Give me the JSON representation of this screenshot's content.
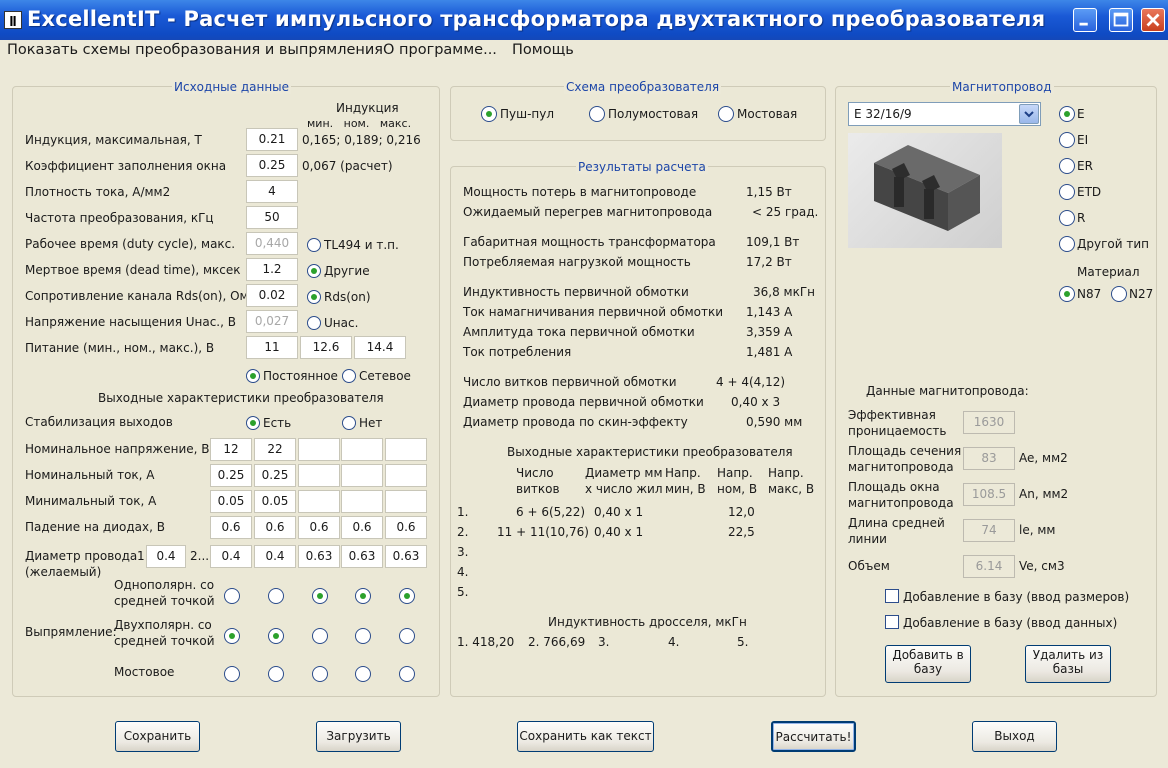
{
  "window": {
    "title": "ExcellentIT - Расчет импульсного трансформатора двухтактного преобразователя"
  },
  "menu": [
    "Показать схемы преобразования и выпрямления",
    "О программе...",
    "Помощь"
  ],
  "input": {
    "title": "Исходные данные",
    "ind_header": "Индукция",
    "ind_cols": "мин.   ном.   макс.",
    "ind_vals": "0,165; 0,189; 0,216",
    "rows": [
      {
        "label": "Индукция, максимальная, Т",
        "value": "0.21"
      },
      {
        "label": "Коэффициент заполнения окна",
        "value": "0.25",
        "note": "0,067 (расчет)"
      },
      {
        "label": "Плотность тока, А/мм2",
        "value": "4"
      },
      {
        "label": "Частота преобразования, кГц",
        "value": "50"
      },
      {
        "label": "Рабочее время (duty cycle), макс.",
        "value": "0,440",
        "radio": "TL494 и т.п."
      },
      {
        "label": "Мертвое время (dead time), мксек",
        "value": "1.2",
        "radio": "Другие"
      },
      {
        "label": "Сопротивление канала Rds(on), Ом",
        "value": "0.02",
        "radio": "Rds(on)"
      },
      {
        "label": "Напряжение насыщения Uнас., В",
        "value": "0,027",
        "radio": "Uнас."
      },
      {
        "label": "Питание (мин., ном., макс.), В",
        "values": [
          "11",
          "12.6",
          "14.4"
        ]
      }
    ],
    "supply": [
      "Постоянное",
      "Сетевое"
    ],
    "out_title": "Выходные характеристики преобразователя",
    "stab_label": "Стабилизация выходов",
    "stab_opts": [
      "Есть",
      "Нет"
    ],
    "out_rows": [
      {
        "label": "Номинальное напряжение, В",
        "values": [
          "12",
          "22",
          "",
          "",
          ""
        ]
      },
      {
        "label": "Номинальный ток, А",
        "values": [
          "0.25",
          "0.25",
          "",
          "",
          ""
        ]
      },
      {
        "label": "Минимальный ток, А",
        "values": [
          "0.05",
          "0.05",
          "",
          "",
          ""
        ]
      },
      {
        "label": "Падение на диодах, В",
        "values": [
          "0.6",
          "0.6",
          "0.6",
          "0.6",
          "0.6"
        ]
      }
    ],
    "wire_label1": "Диаметр провода",
    "wire_label2": "(желаемый)",
    "wire_n1": "1",
    "wire_n2": "2...",
    "wire_vals": [
      "0.4",
      "0.4",
      "0.4",
      "0.63",
      "0.63",
      "0.63"
    ],
    "rect_label": "Выпрямление:",
    "rect_types": [
      {
        "l1": "Однополярн. со",
        "l2": "средней точкой",
        "sel": [
          false,
          false,
          true,
          true,
          true
        ]
      },
      {
        "l1": "Двухполярн. со",
        "l2": "средней точкой",
        "sel": [
          true,
          true,
          false,
          false,
          false
        ]
      },
      {
        "l1": "Мостовое",
        "l2": "",
        "sel": [
          false,
          false,
          false,
          false,
          false
        ]
      }
    ]
  },
  "scheme": {
    "title": "Схема преобразователя",
    "options": [
      "Пуш-пул",
      "Полумостовая",
      "Мостовая"
    ],
    "selected": 0
  },
  "results": {
    "title": "Результаты расчета",
    "rows": [
      {
        "label": "Мощность потерь в магнитопроводе",
        "value": "1,15 Вт"
      },
      {
        "label": "Ожидаемый перегрев магнитопровода",
        "value": "< 25 град."
      },
      {
        "label": "Габаритная мощность трансформатора",
        "value": "109,1 Вт"
      },
      {
        "label": "Потребляемая нагрузкой мощность",
        "value": "17,2 Вт"
      },
      {
        "label": "Индуктивность первичной обмотки",
        "value": "36,8 мкГн"
      },
      {
        "label": "Ток намагничивания первичной обмотки",
        "value": "1,143 А"
      },
      {
        "label": "Амплитуда тока первичной обмотки",
        "value": "3,359 А"
      },
      {
        "label": "Ток потребления",
        "value": "1,481 А"
      },
      {
        "label": "Число витков первичной обмотки",
        "value": "4 + 4(4,12)"
      },
      {
        "label": "Диаметр провода первичной обмотки",
        "value": "0,40 х 3"
      },
      {
        "label": "Диаметр провода по скин-эффекту",
        "value": "0,590 мм"
      }
    ],
    "out_title": "Выходные характеристики преобразователя",
    "headers": [
      [
        "Число",
        "витков"
      ],
      [
        "Диаметр мм",
        "х число жил"
      ],
      [
        "Напр.",
        "мин, В"
      ],
      [
        "Напр.",
        "ном, В"
      ],
      [
        "Напр.",
        "макс, В"
      ]
    ],
    "out_rows": [
      {
        "n": "1.",
        "turns": "6 + 6(5,22)",
        "dia": "0,40 х 1",
        "nom": "12,0"
      },
      {
        "n": "2.",
        "turns": "11 + 11(10,76)",
        "dia": "0,40 х 1",
        "nom": "22,5"
      },
      {
        "n": "3.",
        "turns": "",
        "dia": "",
        "nom": ""
      },
      {
        "n": "4.",
        "turns": "",
        "dia": "",
        "nom": ""
      },
      {
        "n": "5.",
        "turns": "",
        "dia": "",
        "nom": ""
      }
    ],
    "choke_title": "Индуктивность дросселя, мкГн",
    "choke_vals": [
      "1. 418,20",
      "2. 766,69",
      "3.",
      "4.",
      "5."
    ]
  },
  "core": {
    "title": "Магнитопровод",
    "selected": "E 32/16/9",
    "types": [
      "E",
      "EI",
      "ER",
      "ETD",
      "R",
      "Другой тип"
    ],
    "type_selected": 0,
    "material_title": "Материал",
    "materials": [
      "N87",
      "N27"
    ],
    "material_selected": 0,
    "data_title": "Данные магнитопровода:",
    "params": [
      {
        "l1": "Эффективная",
        "l2": "проницаемость",
        "value": "1630",
        "unit": ""
      },
      {
        "l1": "Площадь сечения",
        "l2": "магнитопровода",
        "value": "83",
        "unit": "Ae, мм2"
      },
      {
        "l1": "Площадь окна",
        "l2": "магнитопровода",
        "value": "108.5",
        "unit": "An, мм2"
      },
      {
        "l1": "Длина средней",
        "l2": "линии",
        "value": "74",
        "unit": "le, мм"
      },
      {
        "l1": "Объем",
        "l2": "",
        "value": "6.14",
        "unit": "Ve, см3"
      }
    ],
    "checks": [
      "Добавление в базу (ввод размеров)",
      "Добавление в базу (ввод данных)"
    ],
    "btn_add": "Добавить в базу",
    "btn_del": "Удалить из базы"
  },
  "buttons": [
    "Сохранить",
    "Загрузить",
    "Сохранить как текст",
    "Рассчитать!",
    "Выход"
  ]
}
